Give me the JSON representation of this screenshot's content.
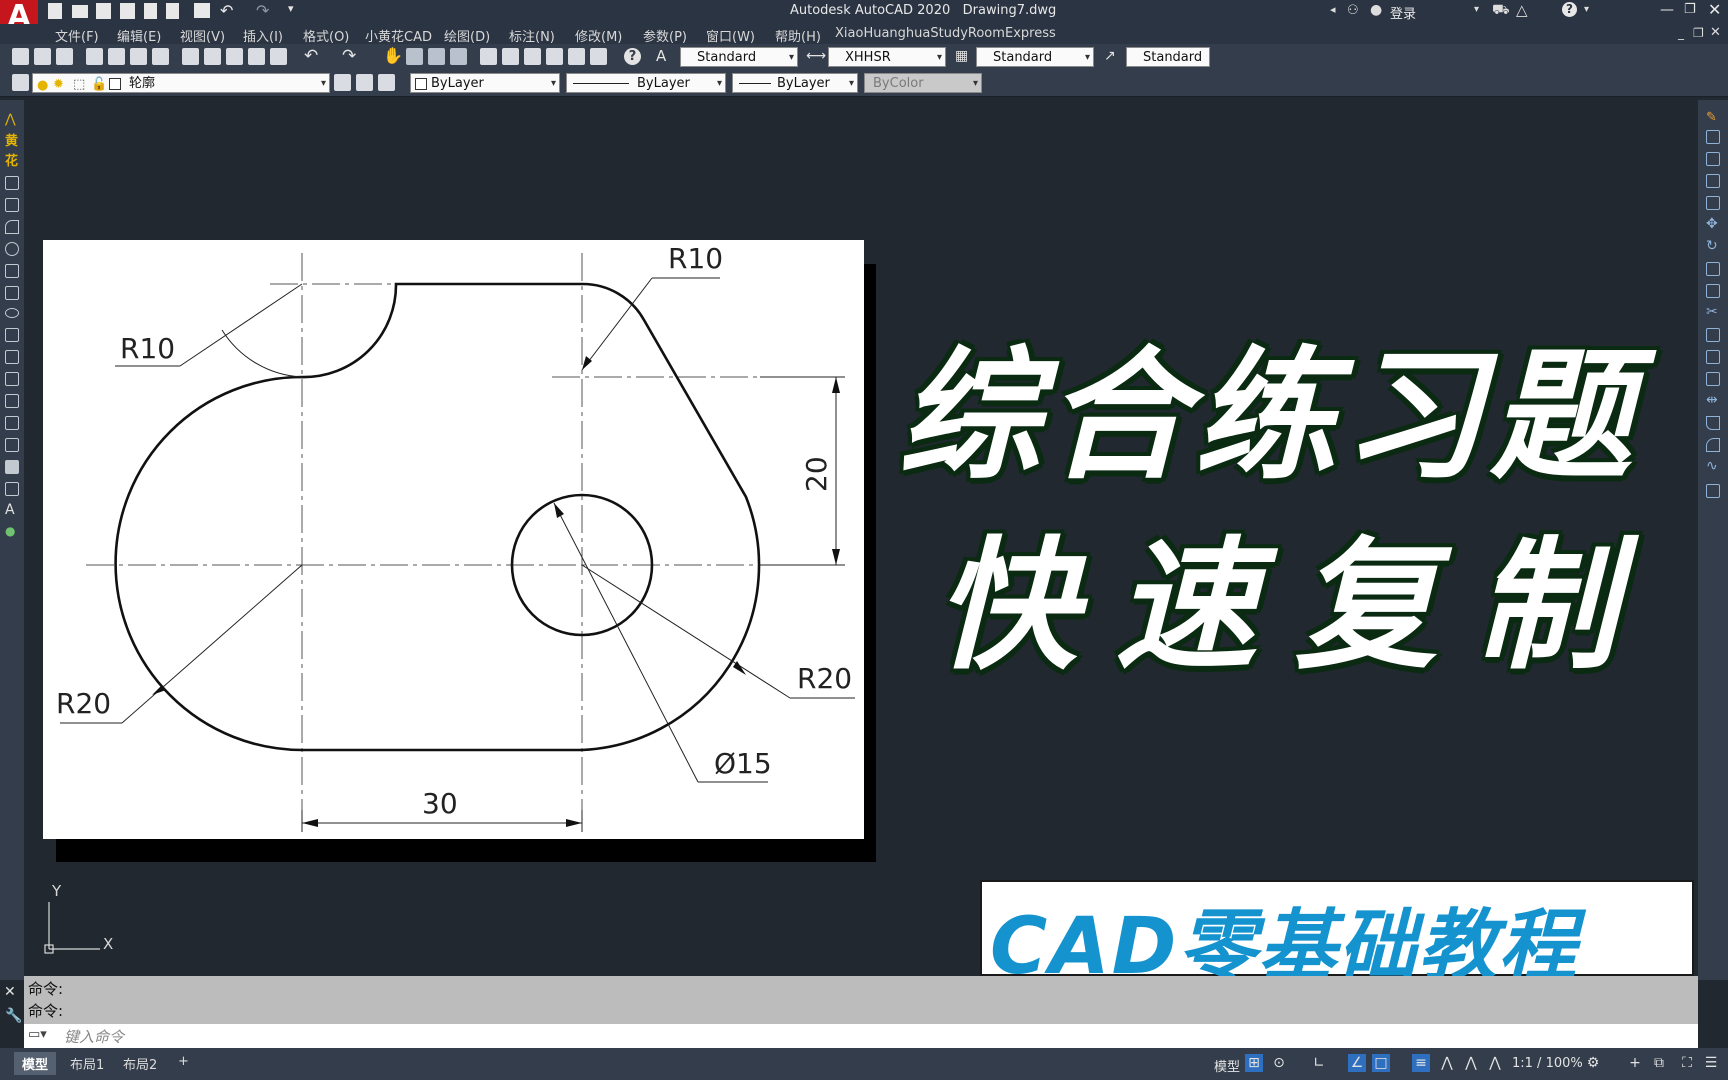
{
  "app": {
    "title": "Autodesk AutoCAD 2020",
    "file": "Drawing7.dwg",
    "login": "登录",
    "logo_letter": "A"
  },
  "menu": [
    "文件(F)",
    "编辑(E)",
    "视图(V)",
    "插入(I)",
    "格式(O)",
    "小黄花CAD",
    "绘图(D)",
    "标注(N)",
    "修改(M)",
    "参数(P)",
    "窗口(W)",
    "帮助(H)",
    "XiaoHuanghuaStudyRoom",
    "Express"
  ],
  "styles_toolbar": {
    "text_style": "Standard",
    "dim_style": "XHHSR",
    "table_style": "Standard",
    "mleader_style": "Standard"
  },
  "layers_toolbar": {
    "layer": "轮廓",
    "color": "ByLayer",
    "linetype": "ByLayer",
    "lineweight": "ByLayer",
    "plotstyle": "ByColor"
  },
  "left_tools_labels": [
    "黄",
    "花"
  ],
  "drawing": {
    "dims": {
      "r10_left": "R10",
      "r10_right": "R10",
      "r20_left": "R20",
      "r20_right": "R20",
      "dia15": "Ø15",
      "d30": "30",
      "d20": "20"
    }
  },
  "overlay": {
    "title_line1": "综合练习题",
    "title_line2": "快速复制",
    "badge": "CAD零基础教程"
  },
  "ucs": {
    "x": "X",
    "y": "Y"
  },
  "command": {
    "history": [
      "命令:",
      "命令:"
    ],
    "placeholder": "键入命令"
  },
  "status": {
    "tabs": [
      "模型",
      "布局1",
      "布局2"
    ],
    "add_tab": "+",
    "model_label": "模型",
    "scale": "1:1 / 100%"
  },
  "colors": {
    "background": "#212830",
    "toolbar": "#333d4b",
    "badge_text": "#1593cf",
    "title_outline": "#0b2a12"
  }
}
